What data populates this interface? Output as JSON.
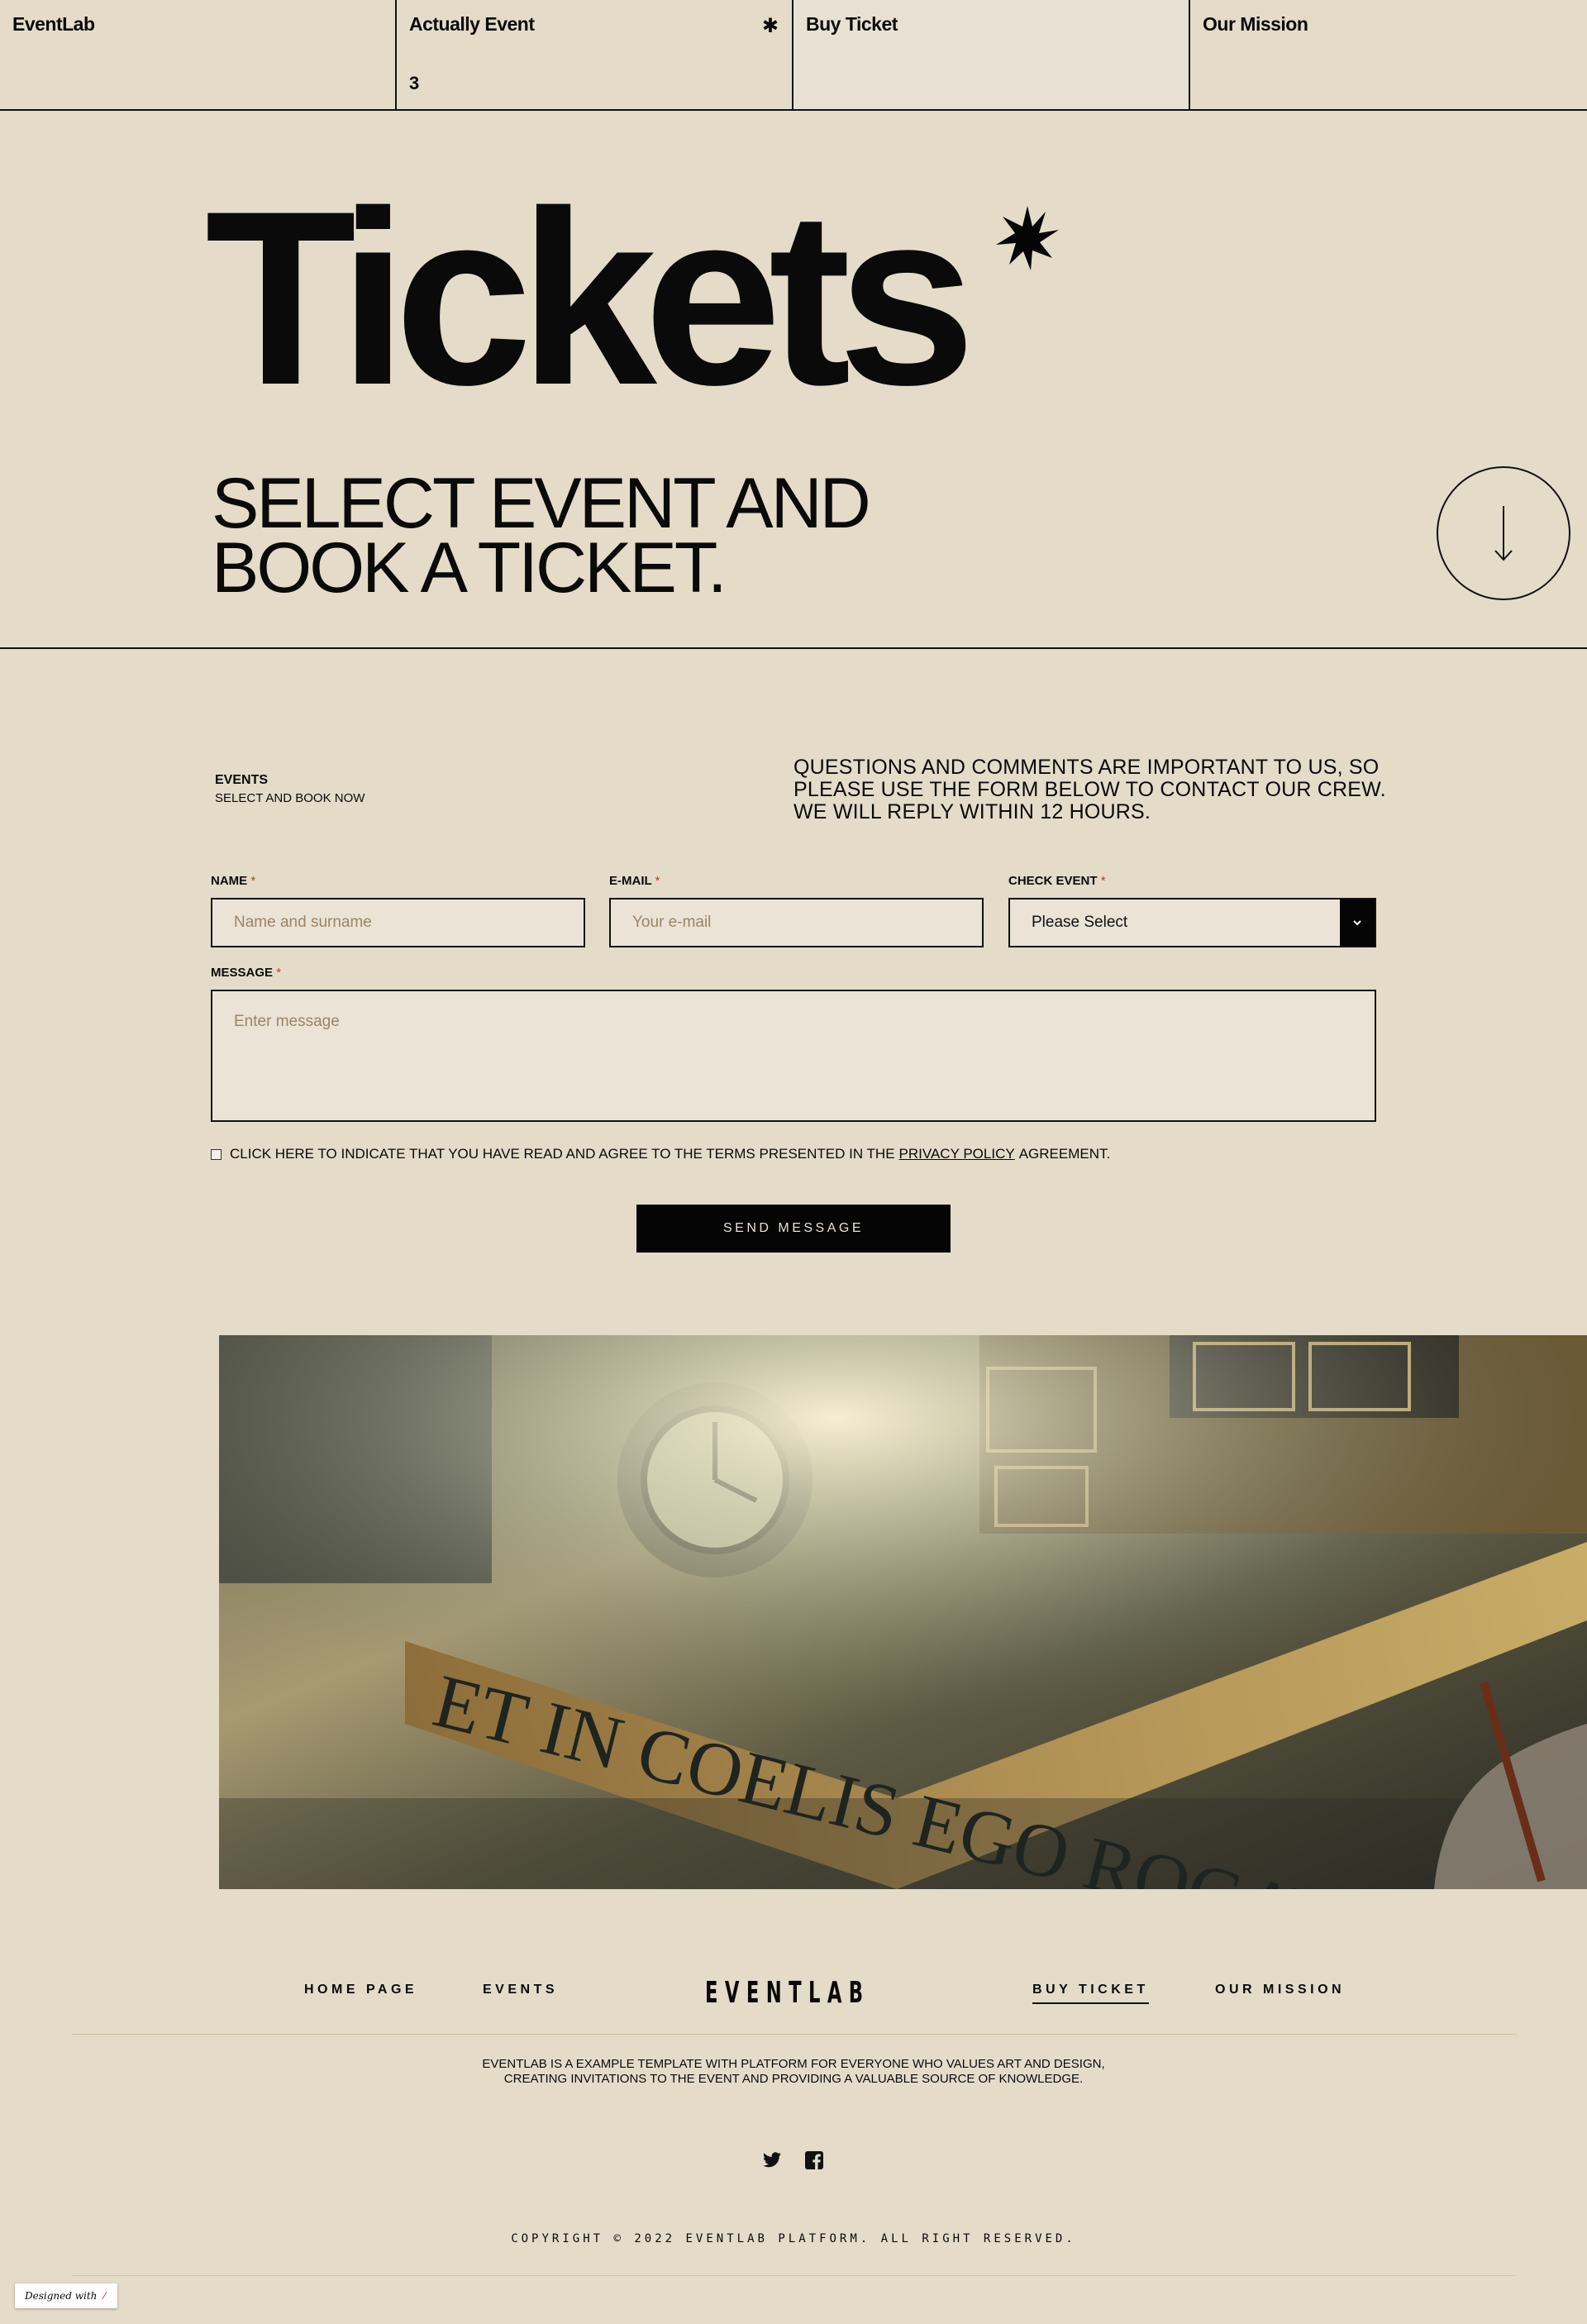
{
  "topnav": {
    "brand": "EventLab",
    "actually_event": "Actually Event",
    "actually_event_count": "3",
    "buy_ticket": "Buy Ticket",
    "our_mission": "Our Mission"
  },
  "hero": {
    "title": "Tickets",
    "subtitle_line1": "SELECT EVENT AND",
    "subtitle_line2": "BOOK A TICKET."
  },
  "intro": {
    "section_title": "EVENTS",
    "section_subtitle": "SELECT AND BOOK NOW",
    "text": "QUESTIONS AND COMMENTS ARE IMPORTANT TO US, SO PLEASE USE THE FORM BELOW TO CONTACT OUR CREW. WE WILL REPLY WITHIN 12 HOURS."
  },
  "form": {
    "name_label": "NAME",
    "name_placeholder": "Name and surname",
    "email_label": "E-MAIL",
    "email_placeholder": "Your e-mail",
    "event_label": "CHECK EVENT",
    "event_value": "Please Select",
    "message_label": "MESSAGE",
    "message_placeholder": "Enter message",
    "required_mark": "*",
    "agree_text": "CLICK HERE TO INDICATE THAT YOU HAVE READ AND AGREE TO THE TERMS PRESENTED IN THE",
    "agree_link": "PRIVACY POLICY",
    "agree_suffix": "AGREEMENT.",
    "submit_label": "SEND MESSAGE"
  },
  "footer": {
    "nav_home": "HOME PAGE",
    "nav_events": "EVENTS",
    "logo": "EVENTLAB",
    "nav_buy": "BUY TICKET",
    "nav_mission": "OUR MISSION",
    "about_line1": "EVENTLAB IS A EXAMPLE TEMPLATE WITH PLATFORM FOR EVERYONE WHO VALUES ART AND DESIGN,",
    "about_line2": "CREATING INVITATIONS TO THE EVENT AND PROVIDING A VALUABLE SOURCE OF KNOWLEDGE.",
    "social": [
      "twitter-icon",
      "facebook-icon"
    ],
    "copyright": "COPYRIGHT © 2022 EVENTLAB PLATFORM. ALL RIGHT RESERVED.",
    "badge": "Designed with"
  },
  "photo": {
    "inscription": "ET IN COELIS EGO ROGAVI PRO T"
  },
  "colors": {
    "background": "#e4dcc9",
    "active_tab": "#e8e1d3",
    "input_bg": "#eae3d6",
    "ink": "#0a0a0a",
    "required": "#c0392b"
  }
}
